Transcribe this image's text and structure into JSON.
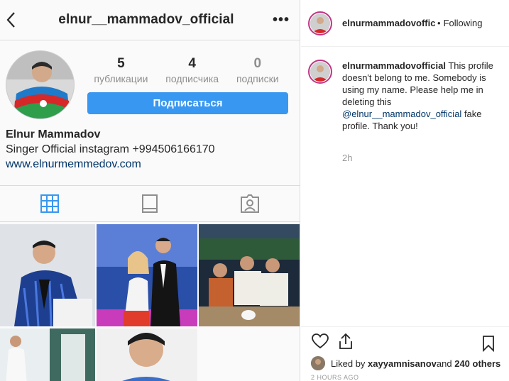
{
  "profile": {
    "username": "elnur__mammadov_official",
    "stats": [
      {
        "count": "5",
        "label": "публикации"
      },
      {
        "count": "4",
        "label": "подписчика"
      },
      {
        "count": "0",
        "label": "подписки"
      }
    ],
    "follow_label": "Подписаться",
    "name": "Elnur Mammadov",
    "bio": "Singer Official instagram +994506166170",
    "website": "www.elnurmemmedov.com"
  },
  "tabs": [
    {
      "name": "grid",
      "icon": "grid-icon"
    },
    {
      "name": "igtv",
      "icon": "tv-icon"
    },
    {
      "name": "tagged",
      "icon": "tagged-icon"
    }
  ],
  "post": {
    "author": "elnurmammadovofficial",
    "dot": "•",
    "following_label": "Following",
    "caption_user": "elnurmammadovofficial",
    "caption_text": " This profile doesn't belong to me. Somebody is using my name. Please help me in deleting this ",
    "caption_mention": "@elnur__mammadov_official",
    "caption_end": " fake profile. Thank you!",
    "time_ago": "2h",
    "liked_by_prefix": "Liked by ",
    "liked_by_user": "xayyamnisanov",
    "liked_by_mid": " and ",
    "liked_by_others": "240 others",
    "date": "2 HOURS AGO"
  },
  "colors": {
    "accent": "#3897f0",
    "link": "#003569",
    "muted": "#8e8e8e",
    "border": "#dbdbdb"
  }
}
